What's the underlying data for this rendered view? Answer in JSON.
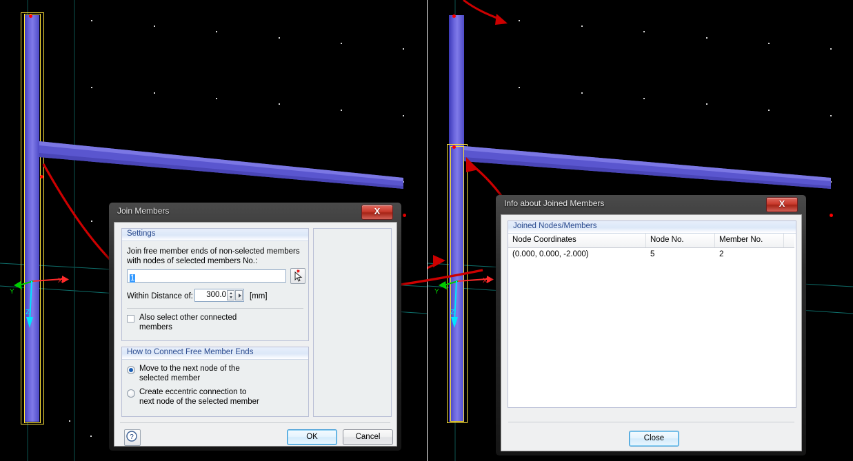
{
  "app": {
    "viewports": [
      {
        "name": "left-viewport",
        "axes": [
          {
            "label": "X",
            "color": "#ff2a2a"
          },
          {
            "label": "Y",
            "color": "#00dd00"
          },
          {
            "label": "Z",
            "color": "#00e5ff"
          }
        ]
      },
      {
        "name": "right-viewport",
        "axes": [
          {
            "label": "X",
            "color": "#ff2a2a"
          },
          {
            "label": "Y",
            "color": "#00dd00"
          },
          {
            "label": "Z",
            "color": "#00e5ff"
          }
        ]
      }
    ],
    "colors": {
      "member": "#5a56cf",
      "selection_highlight": "#ffe33a",
      "node": "#ff0000",
      "annotation_arrow": "#cc0000",
      "background": "#000000",
      "group_header_text": "#2b4b8f",
      "accent_default_button": "#3c9ad6"
    }
  },
  "join_dialog": {
    "title": "Join Members",
    "close_glyph": "X",
    "settings": {
      "header": "Settings",
      "description_line1": "Join free member ends of non-selected members",
      "description_line2": "with nodes of selected members No.:",
      "members_value": "1",
      "pick_icon": "pick-cursor-icon",
      "distance_label": "Within Distance of:",
      "distance_value": "300.0",
      "distance_unit": "[mm]",
      "checkbox_label_line1": "Also select other connected",
      "checkbox_label_line2": "members",
      "checkbox_checked": false
    },
    "connect": {
      "header": "How to Connect Free Member Ends",
      "options": [
        {
          "line1": "Move to the next node of the",
          "line2": "selected member",
          "selected": true
        },
        {
          "line1": "Create eccentric connection to",
          "line2": "next node of the selected member",
          "selected": false
        }
      ]
    },
    "footer": {
      "help_icon": "help-question-icon",
      "ok_label": "OK",
      "cancel_label": "Cancel"
    }
  },
  "info_dialog": {
    "title": "Info about Joined Members",
    "close_glyph": "X",
    "group_header": "Joined Nodes/Members",
    "table": {
      "columns": [
        "Node Coordinates",
        "Node No.",
        "Member No.",
        ""
      ],
      "rows": [
        [
          "(0.000, 0.000, -2.000)",
          "5",
          "2",
          ""
        ]
      ]
    },
    "close_label": "Close"
  }
}
